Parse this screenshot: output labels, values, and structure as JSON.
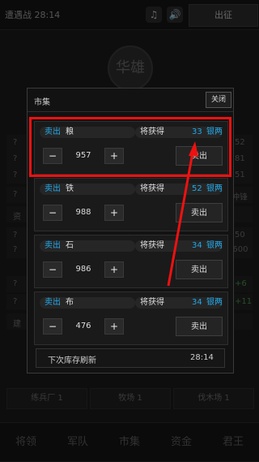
{
  "header": {
    "title": "遭遇战 28:14",
    "music_icon": "♫",
    "sound_icon": "🔊",
    "action": "出征"
  },
  "emblem_text": "华雄",
  "background_rows": [
    {
      "left": "?",
      "right": "52"
    },
    {
      "left": "?",
      "right": "81"
    },
    {
      "left": "?",
      "right": "51"
    },
    {
      "left": "?",
      "right": "冲锋"
    },
    {
      "left": "资",
      "right": ""
    },
    {
      "left": "?",
      "right": "50"
    },
    {
      "left": "?",
      "right": "/600"
    },
    {
      "left": "?",
      "right": "+6"
    },
    {
      "left": "?",
      "right": "+11"
    },
    {
      "left": "建",
      "right": ""
    }
  ],
  "background_buildings": [
    "练兵厂 1",
    "牧场 1",
    "伐木场 1"
  ],
  "nav": {
    "items": [
      "将领",
      "军队",
      "市集",
      "资金",
      "君王"
    ]
  },
  "dialog": {
    "title": "市集",
    "close_label": "关闭",
    "sell_tag": "卖出",
    "earn_label": "将获得",
    "currency": "银两",
    "sell_button": "卖出",
    "minus": "−",
    "plus": "+",
    "items": [
      {
        "name": "粮",
        "quantity": "957",
        "price": "33"
      },
      {
        "name": "铁",
        "quantity": "988",
        "price": "52"
      },
      {
        "name": "石",
        "quantity": "986",
        "price": "34"
      },
      {
        "name": "布",
        "quantity": "476",
        "price": "34"
      }
    ],
    "footer_label": "下次库存刷新",
    "footer_time": "28:14"
  },
  "colors": {
    "accent": "#22a8e8",
    "highlight": "#ee1111"
  }
}
